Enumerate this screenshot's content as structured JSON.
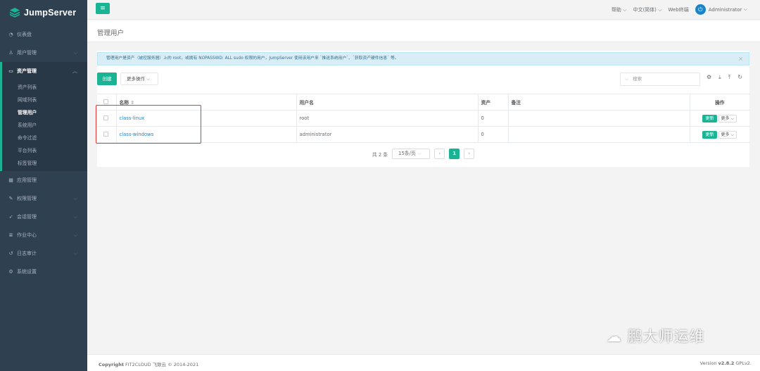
{
  "app": {
    "name": "JumpServer"
  },
  "sidebar": {
    "items_top": [
      {
        "icon": "dashboard-icon",
        "glyph": "◔",
        "label": "仪表盘"
      },
      {
        "icon": "users-icon",
        "glyph": "♙",
        "label": "用户管理"
      }
    ],
    "group": {
      "icon": "inbox-icon",
      "glyph": "▭",
      "label": "资产管理",
      "subitems": [
        "资产列表",
        "网域列表",
        "管理用户",
        "系统用户",
        "命令过滤",
        "平台列表",
        "标签管理"
      ],
      "active_index": 2
    },
    "items_bottom": [
      {
        "icon": "grid-icon",
        "glyph": "▦",
        "label": "应用管理"
      },
      {
        "icon": "edit-icon",
        "glyph": "✎",
        "label": "权限管理"
      },
      {
        "icon": "rocket-icon",
        "glyph": "➶",
        "label": "会话管理"
      },
      {
        "icon": "tasks-icon",
        "glyph": "≣",
        "label": "作业中心"
      },
      {
        "icon": "history-icon",
        "glyph": "↺",
        "label": "日志审计"
      },
      {
        "icon": "cogs-icon",
        "glyph": "⚙",
        "label": "系统设置"
      }
    ]
  },
  "topbar": {
    "toggle_glyph": "≡",
    "help": "帮助",
    "language": "中文(简体)",
    "web_terminal": "Web终端",
    "user": "Administrator"
  },
  "page": {
    "title": "管理用户"
  },
  "alert": {
    "text": "管理用户是资产（被控服务器）上的 root，或拥有 NOPASSWD: ALL sudo 权限的用户，JumpServer 使用该用户来 `推送系统用户`、`获取资产硬件信息` 等。",
    "close": "×"
  },
  "toolbar": {
    "create": "创建",
    "more_actions": "更多操作",
    "search_placeholder": "搜索"
  },
  "table": {
    "headers": {
      "name": "名称",
      "username": "用户名",
      "assets": "资产",
      "comment": "备注",
      "actions": "操作"
    },
    "rows": [
      {
        "name": "class-linux",
        "username": "root",
        "assets": "0",
        "comment": "",
        "update": "更新",
        "more": "更多"
      },
      {
        "name": "class-windows",
        "username": "administrator",
        "assets": "0",
        "comment": "",
        "update": "更新",
        "more": "更多"
      }
    ]
  },
  "pagination": {
    "total": "共 2 条",
    "page_size": "15条/页",
    "current_page": "1",
    "prev": "‹",
    "next": "›"
  },
  "footer": {
    "copyright_bold": "Copyright",
    "copyright": " FIT2CLOUD 飞致云 © 2014-2021",
    "version_label": "Version ",
    "version": "v2.8.2",
    "license": " GPLv2."
  },
  "watermark": "鹏大师运维",
  "colors": {
    "accent": "#1ab394",
    "sidebar": "#2f4050",
    "link": "#1c84c6",
    "highlight_box": "#e33a3a"
  }
}
